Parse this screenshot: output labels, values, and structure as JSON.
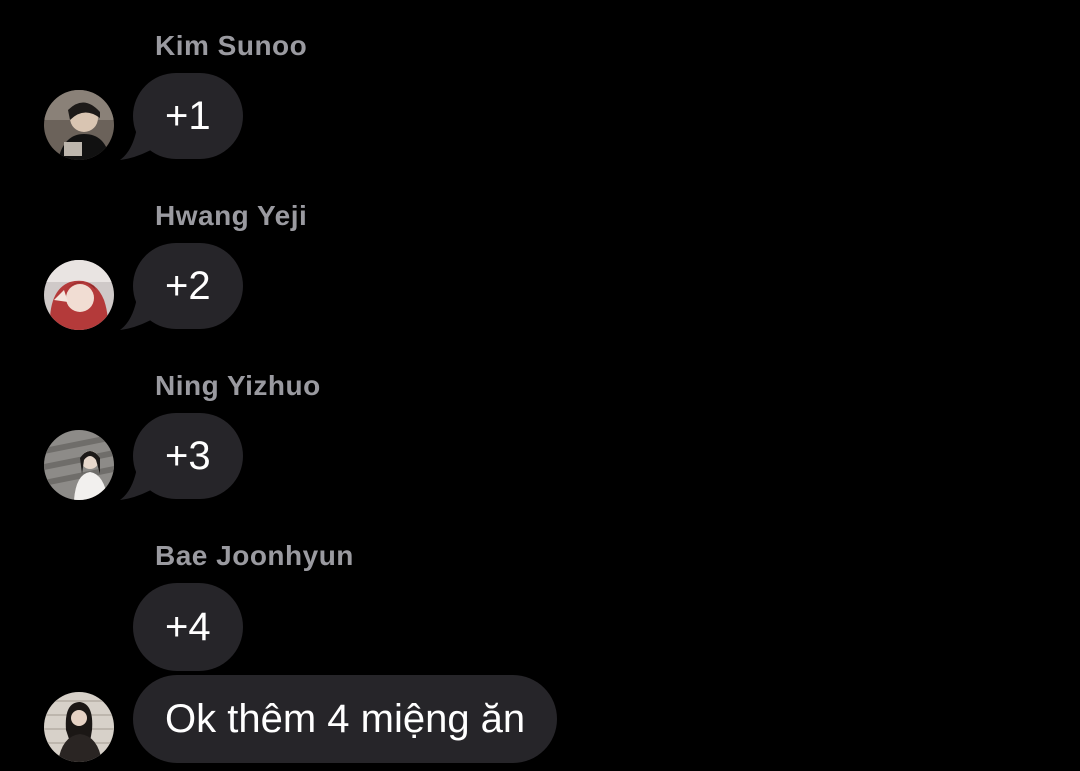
{
  "messages": [
    {
      "sender": "Kim Sunoo",
      "text": "+1"
    },
    {
      "sender": "Hwang Yeji",
      "text": "+2"
    },
    {
      "sender": "Ning Yizhuo",
      "text": "+3"
    },
    {
      "sender": "Bae Joonhyun",
      "text": "+4"
    },
    {
      "sender": "",
      "text": "Ok thêm 4 miệng ăn"
    }
  ],
  "colors": {
    "background": "#000000",
    "bubble": "#262529",
    "sender_name": "#9a9aa0",
    "text": "#ffffff"
  }
}
